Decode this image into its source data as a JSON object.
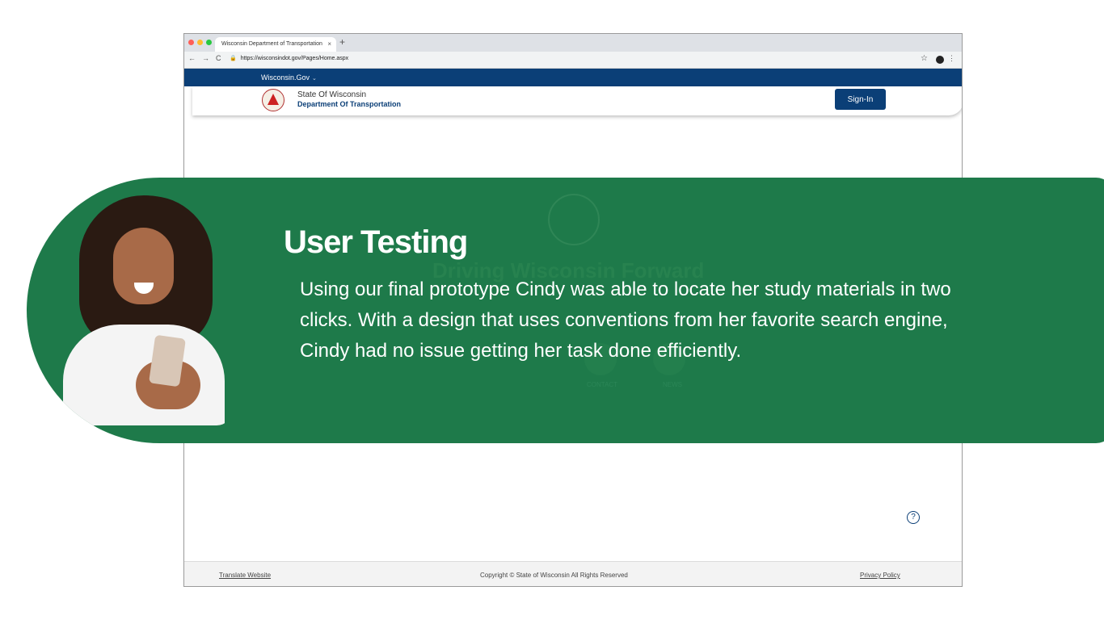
{
  "browser": {
    "tab_title": "Wisconsin Department of Transportation",
    "tab_close": "×",
    "new_tab": "+",
    "url": "https://wisconsindot.gov/Pages/Home.aspx"
  },
  "site": {
    "gov_link": "Wisconsin.Gov",
    "state_name": "State Of Wisconsin",
    "department_name": "Department Of Transportation",
    "signin_label": "Sign-In",
    "background_slogan": "Driving Wisconsin Forward",
    "background_link_1": "CONTACT",
    "background_link_2": "NEWS",
    "help_glyph": "?"
  },
  "footer": {
    "translate": "Translate Website",
    "copyright": "Copyright © State of Wisconsin All Rights Reserved",
    "privacy": "Privacy Policy"
  },
  "banner": {
    "title": "User Testing",
    "text": "Using our final prototype Cindy was able to locate her study materials in two clicks. With a design that uses conventions from her favorite search engine, Cindy had no issue getting her task done efficiently."
  },
  "colors": {
    "brand_blue": "#0b3f77",
    "banner_green": "#1e7a4a"
  }
}
